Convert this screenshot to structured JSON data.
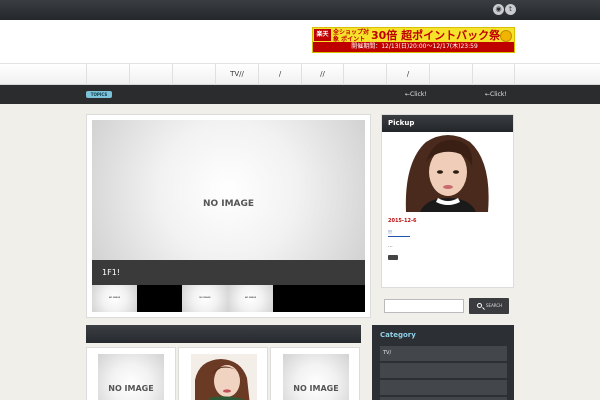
{
  "social": {
    "icons": [
      "rss-icon",
      "twitter-icon"
    ],
    "rss_glyph": "◉",
    "twitter_glyph": "t"
  },
  "banner": {
    "brand": "楽天",
    "line1": "全ショップ対象 ポイント最大",
    "headline": "30倍 超ポイントバック祭",
    "period": "開催期間：12/13(日)20:00～12/17(木)23:59"
  },
  "nav": {
    "items": [
      "",
      "",
      "",
      "TV//",
      "/",
      "//",
      "",
      "/",
      "",
      ""
    ]
  },
  "ticker": {
    "badge": "TOPICS",
    "click_left": "←Click!",
    "click_right": "←Click!"
  },
  "slider": {
    "main_image": "NO IMAGE",
    "caption": "1F1!",
    "thumbs": [
      "NO IMAGE",
      "",
      "NO IMAGE",
      "NO IMAGE",
      ""
    ]
  },
  "cards": [
    {
      "image": "NO IMAGE"
    },
    {
      "image": ""
    },
    {
      "image": "NO IMAGE"
    }
  ],
  "pickup": {
    "title": "Pickup",
    "date": "2015-12-6",
    "link": "!!",
    "dots": "..."
  },
  "search": {
    "placeholder": "",
    "button": "SEARCH"
  },
  "category": {
    "title": "Category",
    "items": [
      "TV/",
      "",
      "",
      ""
    ]
  },
  "colors": {
    "dark_bar": "#2b2c2d",
    "accent": "#7cc2d8",
    "date_red": "#bb1111"
  }
}
